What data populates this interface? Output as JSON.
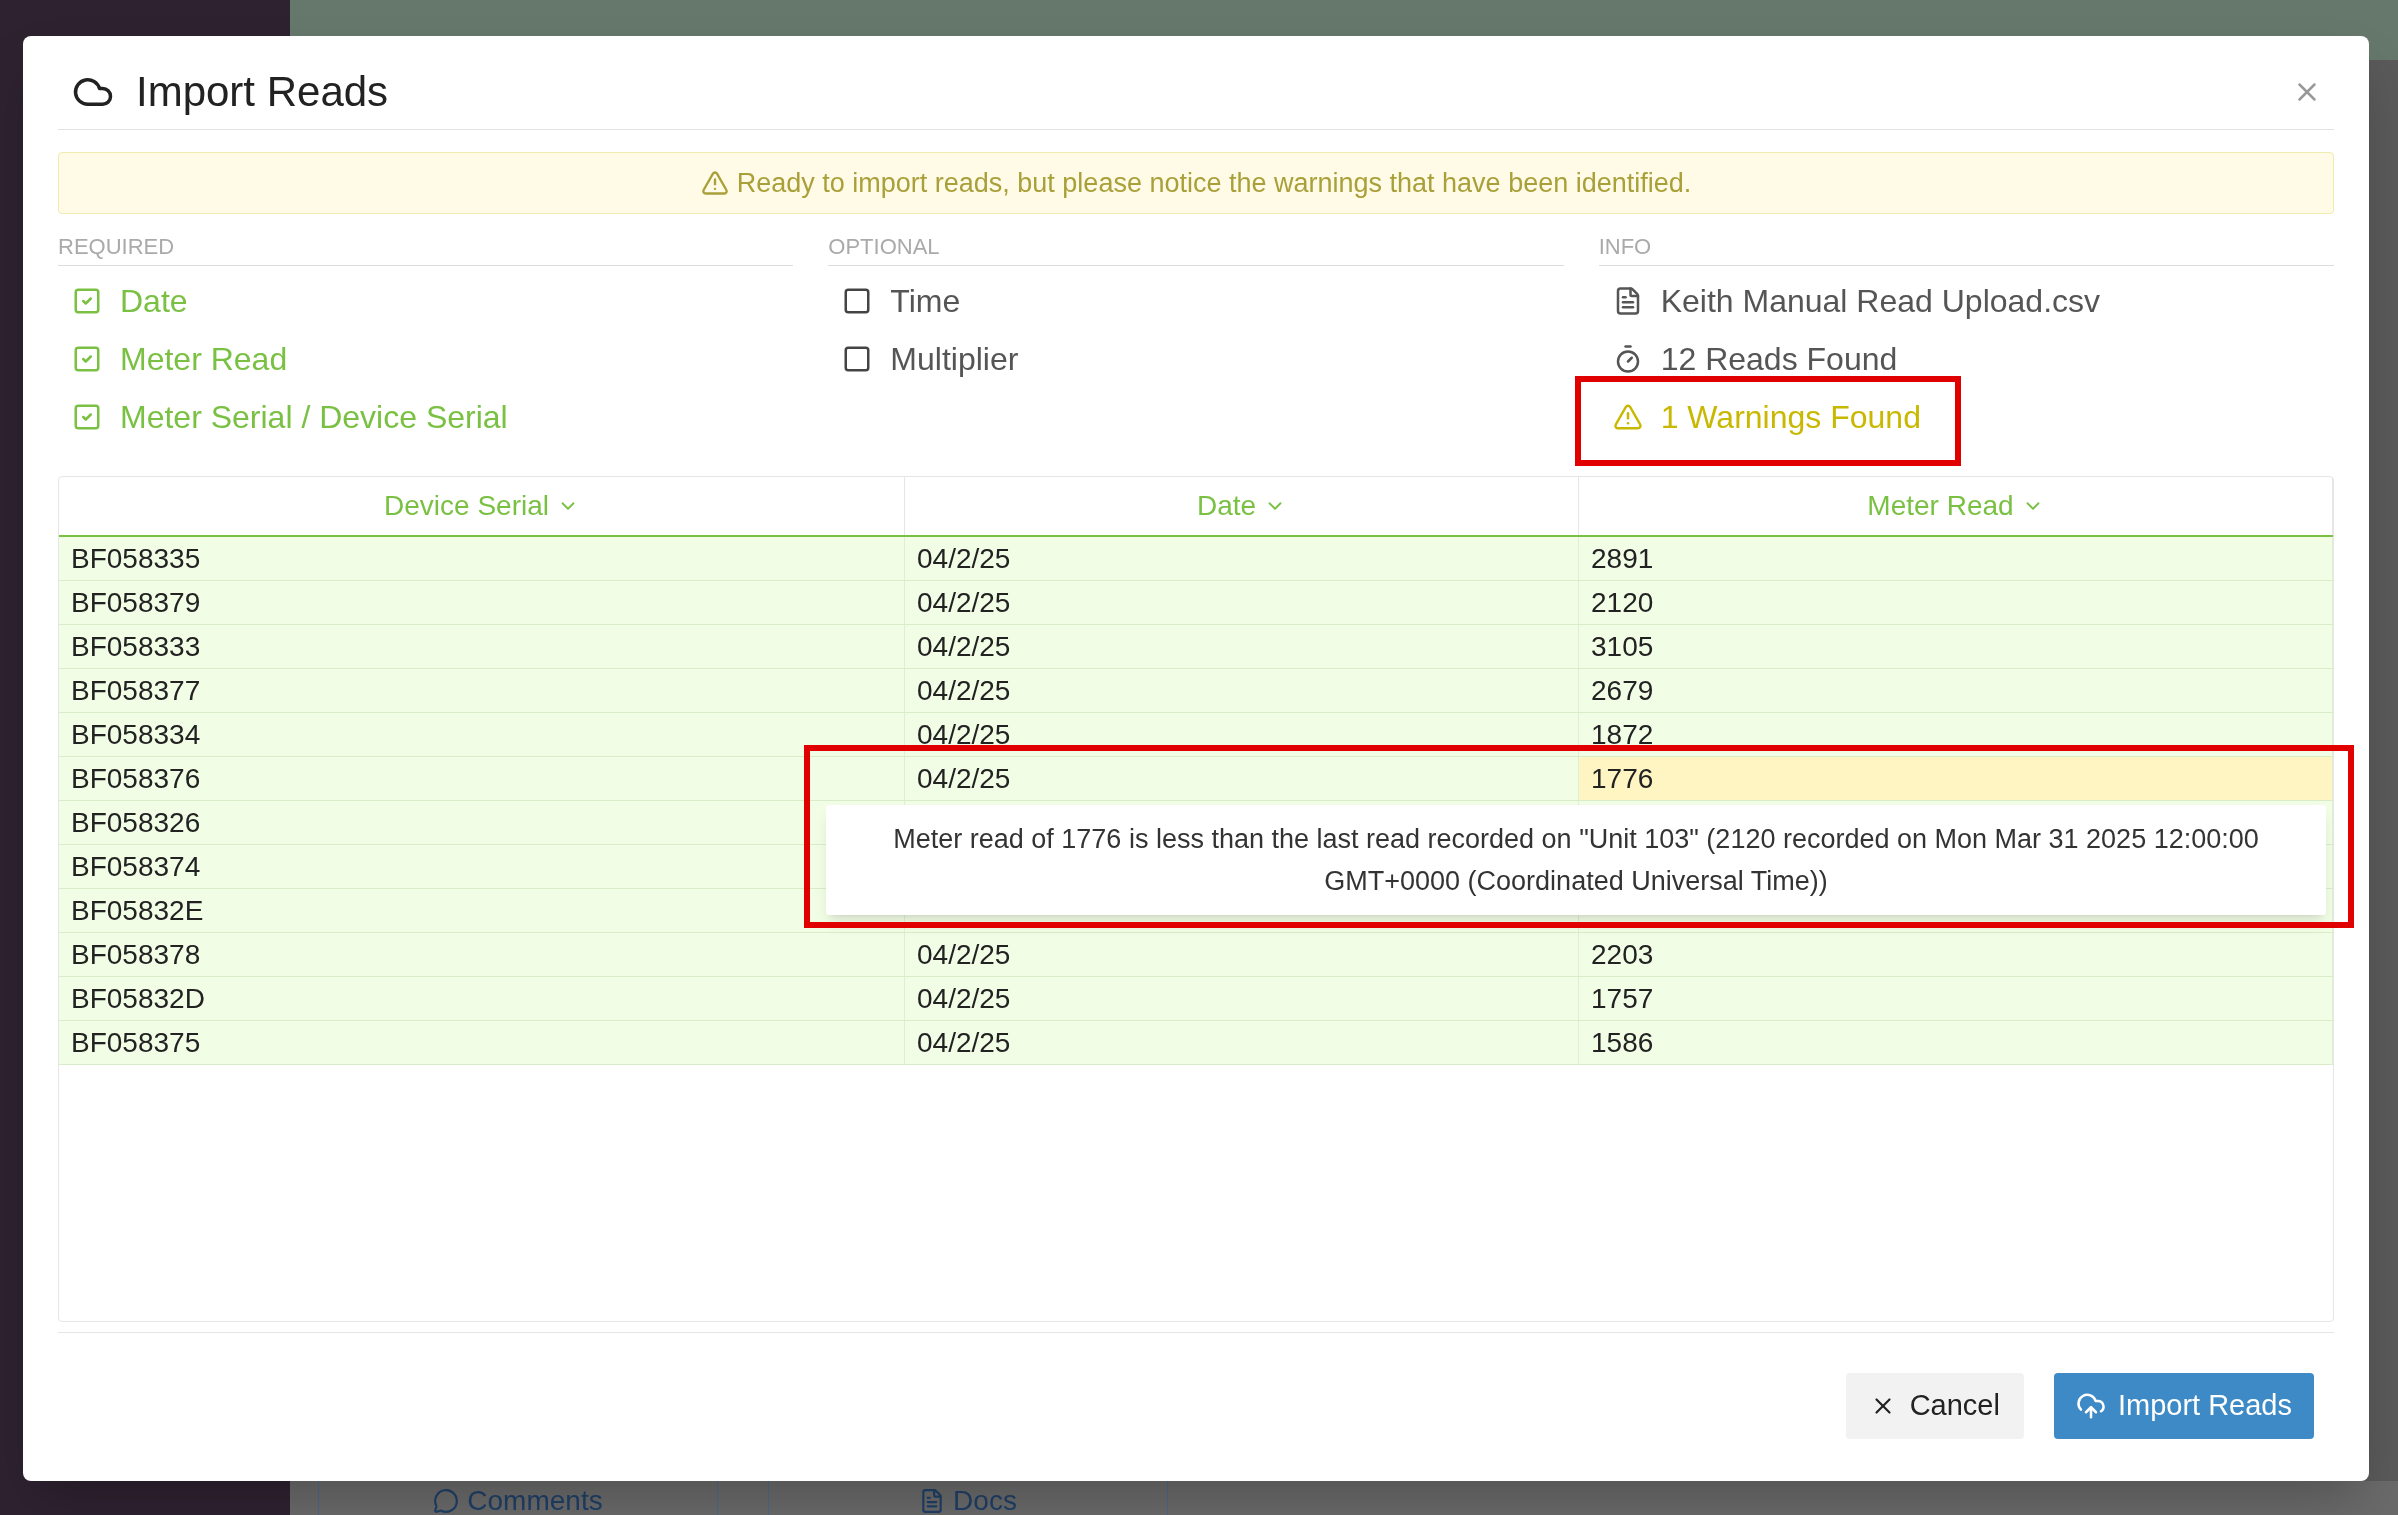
{
  "background": {
    "tabs": [
      {
        "label": "Comments",
        "kind": "comment"
      },
      {
        "label": "Docs",
        "kind": "doc"
      }
    ]
  },
  "dialog": {
    "title": "Import Reads",
    "banner": "Ready to import reads, but please notice the warnings that have been identified.",
    "sections": [
      {
        "heading": "REQUIRED",
        "items": [
          {
            "label": "Date",
            "kind": "check",
            "checked": true
          },
          {
            "label": "Meter Read",
            "kind": "check",
            "checked": true
          },
          {
            "label": "Meter Serial / Device Serial",
            "kind": "check",
            "checked": true
          }
        ]
      },
      {
        "heading": "OPTIONAL",
        "items": [
          {
            "label": "Time",
            "kind": "check",
            "checked": false
          },
          {
            "label": "Multiplier",
            "kind": "check",
            "checked": false
          }
        ]
      },
      {
        "heading": "INFO",
        "items": [
          {
            "label": "Keith Manual Read Upload.csv",
            "kind": "file",
            "highlighted": false
          },
          {
            "label": "12 Reads Found",
            "kind": "reads",
            "highlighted": false
          },
          {
            "label": "1 Warnings Found",
            "kind": "warning",
            "highlighted": true
          }
        ]
      }
    ],
    "table": {
      "columns": [
        "Device Serial",
        "Date",
        "Meter Read"
      ],
      "rows": [
        {
          "cells": [
            "BF058335",
            "04/2/25",
            "2891"
          ],
          "warning": false
        },
        {
          "cells": [
            "BF058379",
            "04/2/25",
            "2120"
          ],
          "warning": false
        },
        {
          "cells": [
            "BF058333",
            "04/2/25",
            "3105"
          ],
          "warning": false
        },
        {
          "cells": [
            "BF058377",
            "04/2/25",
            "2679"
          ],
          "warning": false
        },
        {
          "cells": [
            "BF058334",
            "04/2/25",
            "1872"
          ],
          "warning": false
        },
        {
          "cells": [
            "BF058376",
            "04/2/25",
            "1776"
          ],
          "warning": true
        },
        {
          "cells": [
            "BF058326"
          ]
        },
        {
          "cells": [
            "BF058374"
          ]
        },
        {
          "cells": [
            "BF05832E"
          ]
        },
        {
          "cells": [
            "BF058378",
            "04/2/25",
            "2203"
          ],
          "warning": false
        },
        {
          "cells": [
            "BF05832D",
            "04/2/25",
            "1757"
          ],
          "warning": false
        },
        {
          "cells": [
            "BF058375",
            "04/2/25",
            "1586"
          ],
          "warning": false
        }
      ]
    },
    "tooltip": {
      "text": "Meter read of 1776 is less than the last read recorded on \"Unit 103\" (2120 recorded on Mon Mar 31 2025 12:00:00 GMT+0000 (Coordinated Universal Time))",
      "highlighted": true
    },
    "buttons": [
      {
        "label": "Cancel",
        "kind": "cancel"
      },
      {
        "label": "Import Reads",
        "kind": "primary"
      }
    ]
  }
}
